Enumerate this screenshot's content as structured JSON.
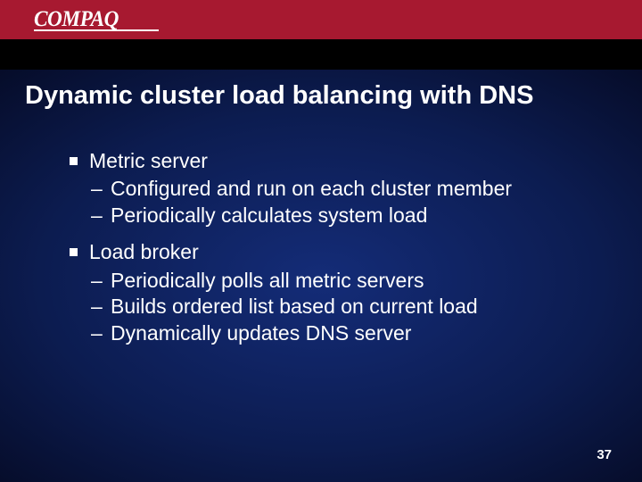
{
  "logo": {
    "text": "COMPAQ"
  },
  "title": "Dynamic cluster load balancing with DNS",
  "bullets": {
    "b1": {
      "label": "Metric server",
      "s1": "Configured and run on each cluster member",
      "s2": "Periodically calculates system load"
    },
    "b2": {
      "label": "Load broker",
      "s1": "Periodically polls all metric servers",
      "s2": "Builds ordered list based on current load",
      "s3": "Dynamically updates DNS server"
    }
  },
  "page_number": "37"
}
